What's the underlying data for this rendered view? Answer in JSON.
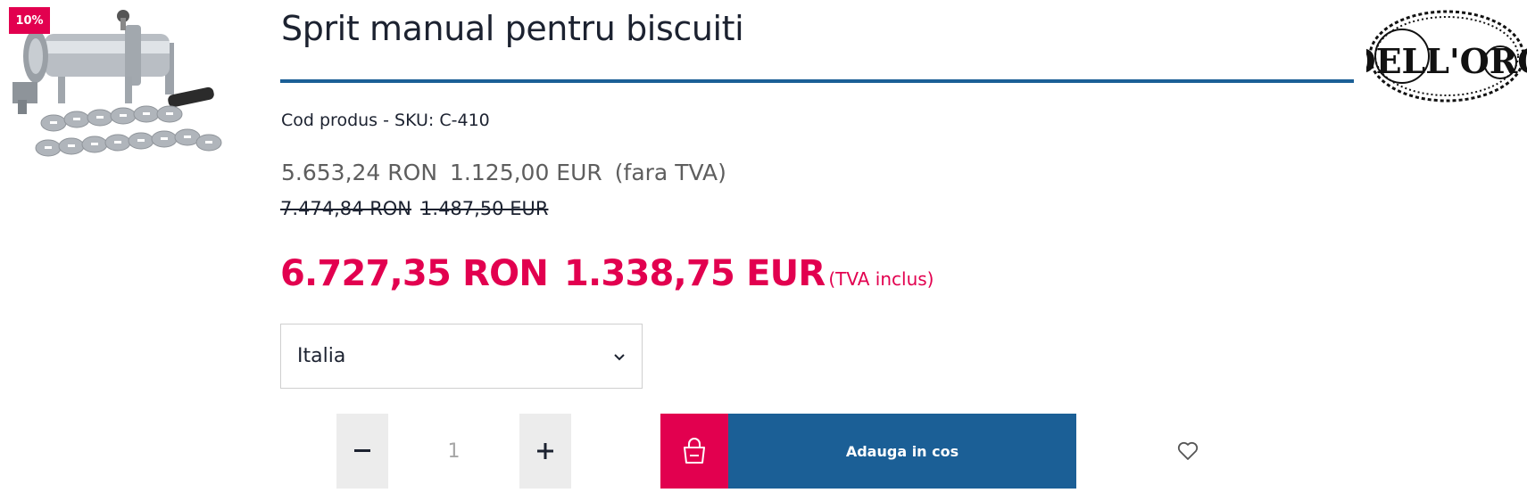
{
  "badge": "10%",
  "product": {
    "title": "Sprit manual pentru biscuiti",
    "sku": "Cod produs - SKU: C-410"
  },
  "brand": {
    "logo_text": "DELL'ORO"
  },
  "prices": {
    "net_ron": "5.653,24 RON",
    "net_eur": "1.125,00 EUR",
    "net_note": "(fara TVA)",
    "old_ron": "7.474,84 RON",
    "old_eur": "1.487,50 EUR",
    "gross_ron": "6.727,35 RON",
    "gross_eur": "1.338,75 EUR",
    "gross_note": "(TVA inclus)"
  },
  "origin_select": {
    "selected": "Italia"
  },
  "quantity": {
    "value": "1",
    "minus": "−",
    "plus": "+"
  },
  "cart": {
    "add_label": "Adauga in cos"
  },
  "icons": {
    "dropdown": "chevron-down-icon",
    "bag": "shopping-bag-icon",
    "wishlist": "heart-icon"
  },
  "colors": {
    "accent": "#e2004f",
    "primary": "#1b5f96",
    "text": "#1c2230",
    "muted": "#5e5e5e"
  }
}
